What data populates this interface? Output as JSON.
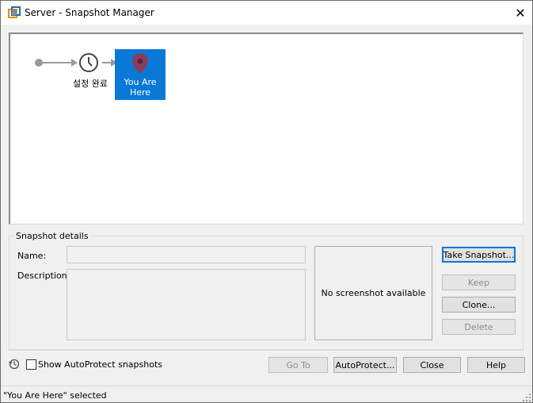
{
  "window": {
    "title": "Server - Snapshot Manager",
    "close_glyph": "✕"
  },
  "timeline": {
    "snapshot_label": "설정 완료",
    "current_label": "You Are Here",
    "current_icon": "location-pin-icon",
    "snapshot_icon": "clock-icon",
    "accent_color": "#0a78d7"
  },
  "details": {
    "group_label": "Snapshot details",
    "name_label": "Name:",
    "name_value": "",
    "description_label": "Description:",
    "description_value": "",
    "screenshot_text": "No screenshot available"
  },
  "actions": {
    "take_snapshot": "Take Snapshot...",
    "keep": "Keep",
    "clone": "Clone...",
    "delete": "Delete"
  },
  "footer": {
    "show_autoprotect_label": "Show AutoProtect snapshots",
    "show_autoprotect_checked": false,
    "goto": "Go To",
    "autoprotect": "AutoProtect...",
    "close": "Close",
    "help": "Help"
  },
  "status": {
    "text": "\"You Are Here\" selected"
  }
}
